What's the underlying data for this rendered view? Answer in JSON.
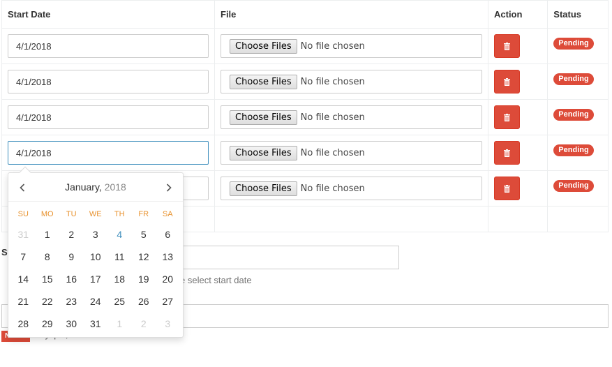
{
  "table": {
    "headers": {
      "start_date": "Start Date",
      "file": "File",
      "action": "Action",
      "status": "Status"
    },
    "rows": [
      {
        "start_date": "4/1/2018",
        "choose_label": "Choose Files",
        "file_text": "No file chosen",
        "status": "Pending"
      },
      {
        "start_date": "4/1/2018",
        "choose_label": "Choose Files",
        "file_text": "No file chosen",
        "status": "Pending"
      },
      {
        "start_date": "4/1/2018",
        "choose_label": "Choose Files",
        "file_text": "No file chosen",
        "status": "Pending"
      },
      {
        "start_date": "4/1/2018",
        "choose_label": "Choose Files",
        "file_text": "No file chosen",
        "status": "Pending"
      },
      {
        "start_date": "",
        "choose_label": "Choose Files",
        "file_text": "No file chosen",
        "status": "Pending"
      }
    ]
  },
  "form_behind": {
    "label_fragment": "St",
    "help_text_fragment": "e select start date",
    "note_badge": "Note:",
    "note_text": "Only .pdf, .doc and .docx file allow"
  },
  "datepicker": {
    "month": "January,",
    "year": "2018",
    "weekdays": [
      "SU",
      "MO",
      "TU",
      "WE",
      "TH",
      "FR",
      "SA"
    ],
    "weeks": [
      [
        "31",
        "1",
        "2",
        "3",
        "4",
        "5",
        "6"
      ],
      [
        "7",
        "8",
        "9",
        "10",
        "11",
        "12",
        "13"
      ],
      [
        "14",
        "15",
        "16",
        "17",
        "18",
        "19",
        "20"
      ],
      [
        "21",
        "22",
        "23",
        "24",
        "25",
        "26",
        "27"
      ],
      [
        "28",
        "29",
        "30",
        "31",
        "1",
        "2",
        "3"
      ]
    ],
    "today": "4",
    "prev_icon": "chevron-left-icon",
    "next_icon": "chevron-right-icon"
  },
  "colors": {
    "danger": "#dd4b39",
    "weekday_header": "#e8922e",
    "today": "#3c8dbc",
    "muted_day": "#cccccc"
  },
  "icons": {
    "delete": "trash-icon"
  }
}
